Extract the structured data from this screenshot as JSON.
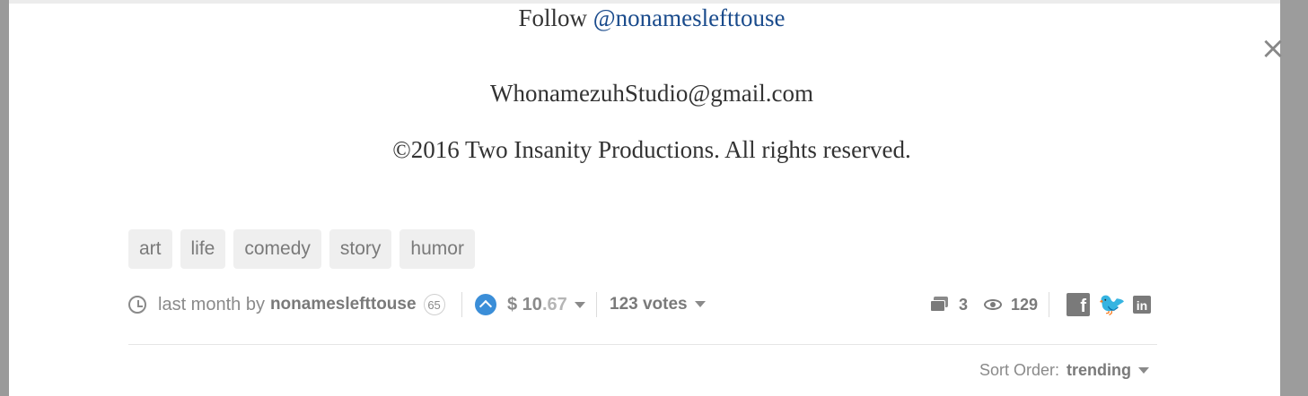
{
  "post": {
    "follow_prefix": "Follow ",
    "follow_handle": "@nonameslefttouse",
    "email": "WhonamezuhStudio@gmail.com",
    "copyright": "©2016 Two Insanity Productions. All rights reserved."
  },
  "tags": [
    "art",
    "life",
    "comedy",
    "story",
    "humor"
  ],
  "meta": {
    "time": "last month by",
    "author": "nonameslefttouse",
    "reputation": "65",
    "payout_dollars": "$ 10",
    "payout_cents": ".67",
    "votes": "123 votes",
    "comments_count": "3",
    "views_count": "129"
  },
  "sort": {
    "label": "Sort Order:",
    "value": "trending"
  },
  "modal": {
    "close_glyph": "×"
  },
  "colors": {
    "link": "#1a4b8c",
    "upvote": "#3b8ed8",
    "muted": "#8a8a8a",
    "tag_bg": "#efefef"
  },
  "icons": [
    "close-icon",
    "clock-icon",
    "upvote-icon",
    "comments-icon",
    "eye-icon",
    "facebook-icon",
    "twitter-icon",
    "linkedin-icon"
  ]
}
